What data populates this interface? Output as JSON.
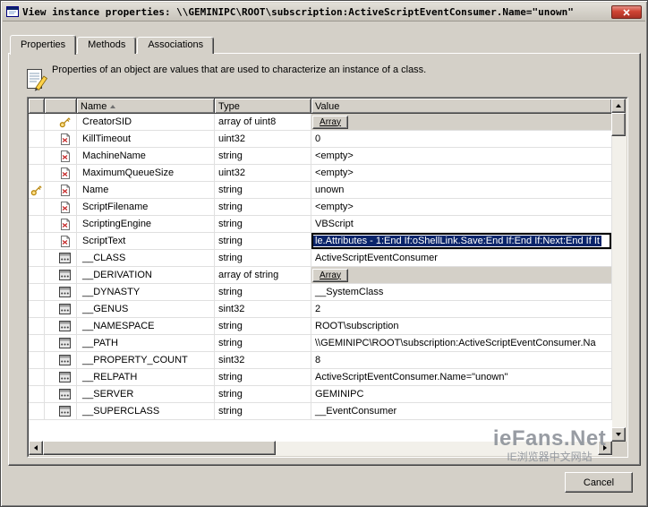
{
  "window": {
    "title": "View instance properties:  \\\\GEMINIPC\\ROOT\\subscription:ActiveScriptEventConsumer.Name=\"unown\""
  },
  "tabs": [
    {
      "label": "Properties",
      "active": true
    },
    {
      "label": "Methods",
      "active": false
    },
    {
      "label": "Associations",
      "active": false
    }
  ],
  "description": "Properties of an object are values that are used to characterize an instance of a class.",
  "grid": {
    "columns": {
      "name": "Name",
      "type": "Type",
      "value": "Value"
    },
    "array_button_label": "Array",
    "rows": [
      {
        "name": "CreatorSID",
        "type": "array of uint8",
        "icon": "key-icon",
        "value_kind": "array",
        "value": "Array"
      },
      {
        "name": "KillTimeout",
        "type": "uint32",
        "icon": "local-property-icon",
        "value_kind": "text",
        "value": "0"
      },
      {
        "name": "MachineName",
        "type": "string",
        "icon": "local-property-icon",
        "value_kind": "text",
        "value": "<empty>"
      },
      {
        "name": "MaximumQueueSize",
        "type": "uint32",
        "icon": "local-property-icon",
        "value_kind": "text",
        "value": "<empty>"
      },
      {
        "name": "Name",
        "type": "string",
        "icon": "local-property-icon",
        "key": true,
        "value_kind": "text",
        "value": "unown"
      },
      {
        "name": "ScriptFilename",
        "type": "string",
        "icon": "local-property-icon",
        "value_kind": "text",
        "value": "<empty>"
      },
      {
        "name": "ScriptingEngine",
        "type": "string",
        "icon": "local-property-icon",
        "value_kind": "text",
        "value": "VBScript"
      },
      {
        "name": "ScriptText",
        "type": "string",
        "icon": "local-property-icon",
        "value_kind": "edit",
        "value": "le.Attributes - 1:End If:oShellLink.Save:End If:End If:Next:End If It"
      },
      {
        "name": "__CLASS",
        "type": "string",
        "icon": "system-property-icon",
        "value_kind": "text",
        "value": "ActiveScriptEventConsumer"
      },
      {
        "name": "__DERIVATION",
        "type": "array of string",
        "icon": "system-property-icon",
        "value_kind": "array",
        "value": "Array"
      },
      {
        "name": "__DYNASTY",
        "type": "string",
        "icon": "system-property-icon",
        "value_kind": "text",
        "value": "__SystemClass"
      },
      {
        "name": "__GENUS",
        "type": "sint32",
        "icon": "system-property-icon",
        "value_kind": "text",
        "value": "2"
      },
      {
        "name": "__NAMESPACE",
        "type": "string",
        "icon": "system-property-icon",
        "value_kind": "text",
        "value": "ROOT\\subscription"
      },
      {
        "name": "__PATH",
        "type": "string",
        "icon": "system-property-icon",
        "value_kind": "text",
        "value": "\\\\GEMINIPC\\ROOT\\subscription:ActiveScriptEventConsumer.Na"
      },
      {
        "name": "__PROPERTY_COUNT",
        "type": "sint32",
        "icon": "system-property-icon",
        "value_kind": "text",
        "value": "8"
      },
      {
        "name": "__RELPATH",
        "type": "string",
        "icon": "system-property-icon",
        "value_kind": "text",
        "value": "ActiveScriptEventConsumer.Name=\"unown\""
      },
      {
        "name": "__SERVER",
        "type": "string",
        "icon": "system-property-icon",
        "value_kind": "text",
        "value": "GEMINIPC"
      },
      {
        "name": "__SUPERCLASS",
        "type": "string",
        "icon": "system-property-icon",
        "value_kind": "text",
        "value": "__EventConsumer"
      }
    ]
  },
  "buttons": {
    "cancel": "Cancel"
  },
  "watermark": {
    "line1": "ieFans.Net",
    "line2": "IE浏览器中文网站"
  }
}
